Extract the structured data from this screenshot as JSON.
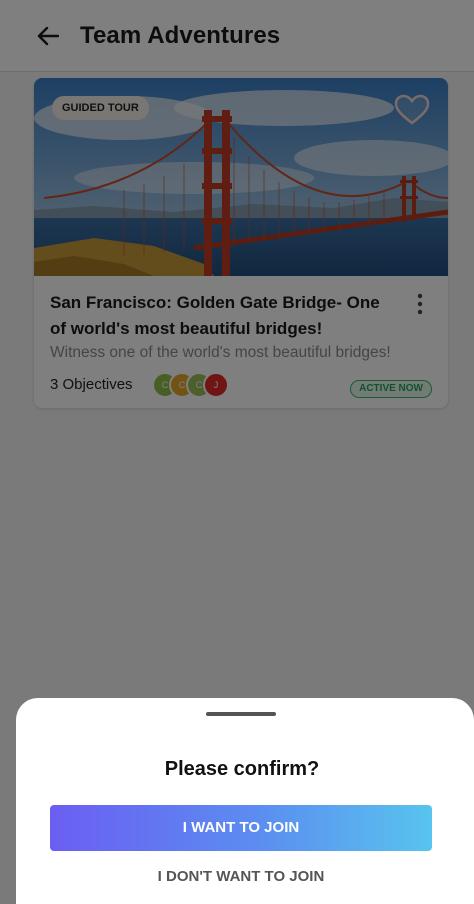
{
  "header": {
    "title": "Team Adventures",
    "back_icon": "arrow-left-icon"
  },
  "card": {
    "badge": "GUIDED TOUR",
    "favorite_icon": "heart-outline-icon",
    "title": "San Francisco: Golden Gate Bridge- One of world's most beautiful bridges!",
    "description": "Witness one of the world's most beautiful bridges!",
    "objectives": "3 Objectives",
    "status": "ACTIVE NOW",
    "more_icon": "more-vertical-icon",
    "avatars": [
      {
        "initial": "C",
        "color": "#8fbf4a"
      },
      {
        "initial": "C",
        "color": "#e5a42a"
      },
      {
        "initial": "C",
        "color": "#9bbf58"
      },
      {
        "initial": "J",
        "color": "#e02828"
      }
    ]
  },
  "sheet": {
    "title": "Please confirm?",
    "join_label": "I WANT TO JOIN",
    "decline_label": "I DON'T WANT TO JOIN"
  },
  "colors": {
    "accent_start": "#6b5ef2",
    "accent_end": "#58c4ee",
    "active_green": "#23a55a",
    "bridge_red": "#c23b22"
  }
}
